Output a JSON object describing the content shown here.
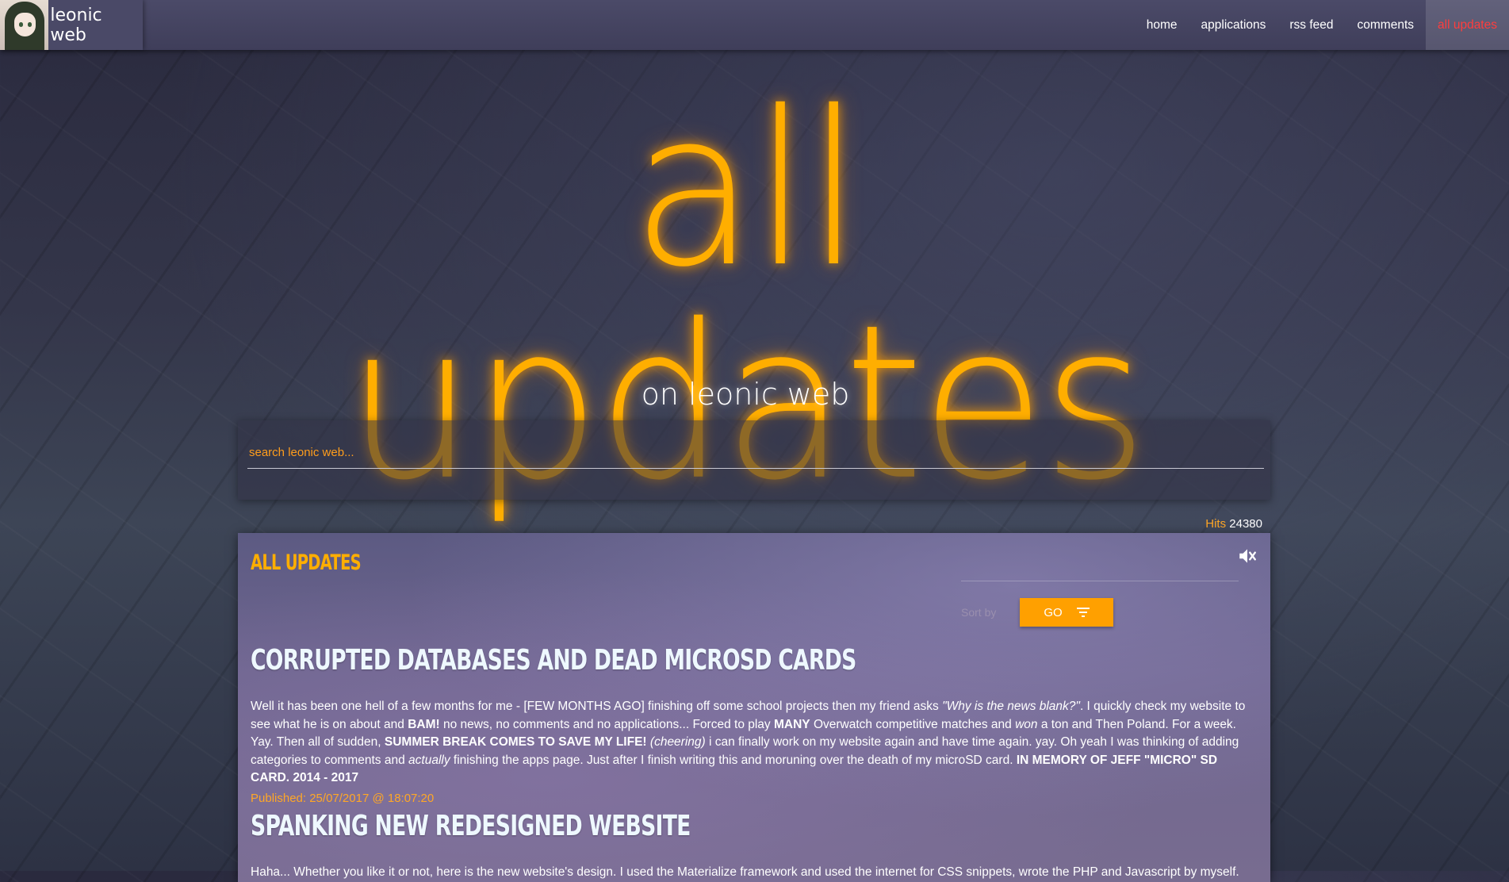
{
  "nav": {
    "brand": "leonic web",
    "links": [
      "home",
      "applications",
      "rss feed",
      "comments",
      "all updates"
    ],
    "active_color": "#ff3d3d"
  },
  "hero": {
    "title": "all updates",
    "subtitle": "on leonic web",
    "accent": "#ffae00"
  },
  "search": {
    "placeholder": "search leonic web..."
  },
  "hits": {
    "label": "Hits",
    "value": "24380"
  },
  "card": {
    "heading": "All Updates",
    "mute_icon": "volume-off-icon",
    "filter_label": "Sort by",
    "go_label": "GO",
    "go_icon": "filter-icon"
  },
  "posts": [
    {
      "title": "Corrupted Databases and Dead MicroSD Cards",
      "body": [
        {
          "t": "Well it has been one hell of a few months for me - [FEW MONTHS AGO] finishing off some school projects then my friend asks ",
          "s": ""
        },
        {
          "t": "\"Why is the news blank?\"",
          "s": "i"
        },
        {
          "t": ". I quickly check my website to see what he is on about and ",
          "s": ""
        },
        {
          "t": "BAM!",
          "s": "b"
        },
        {
          "t": " no news, no comments and no applications... Forced to play ",
          "s": ""
        },
        {
          "t": "MANY",
          "s": "b"
        },
        {
          "t": " Overwatch competitive matches and ",
          "s": ""
        },
        {
          "t": "won",
          "s": "i"
        },
        {
          "t": " a ton and Then Poland. For a week. Yay. Then all of sudden, ",
          "s": ""
        },
        {
          "t": "SUMMER BREAK COMES TO SAVE MY LIFE!",
          "s": "b"
        },
        {
          "t": " ",
          "s": ""
        },
        {
          "t": "(cheering)",
          "s": "i"
        },
        {
          "t": " i can finally work on my website again and have time again. yay. Oh yeah I was thinking of adding categories to comments and ",
          "s": ""
        },
        {
          "t": "actually",
          "s": "i"
        },
        {
          "t": " finishing the apps page. Just after I finish writing this and moruning over the death of my microSD card. ",
          "s": ""
        },
        {
          "t": "IN MEMORY OF JEFF \"MICRO\" SD CARD. 2014 - 2017",
          "s": "b"
        }
      ],
      "published": "Published: 25/07/2017 @ 18:07:20"
    },
    {
      "title": "Spanking New Redesigned Website",
      "body": [
        {
          "t": "Haha... Whether you like it or not, here is the new website's design. I used the Materialize framework and used the internet for CSS snippets, wrote the PHP and Javascript by myself.",
          "s": ""
        }
      ],
      "published": ""
    }
  ]
}
